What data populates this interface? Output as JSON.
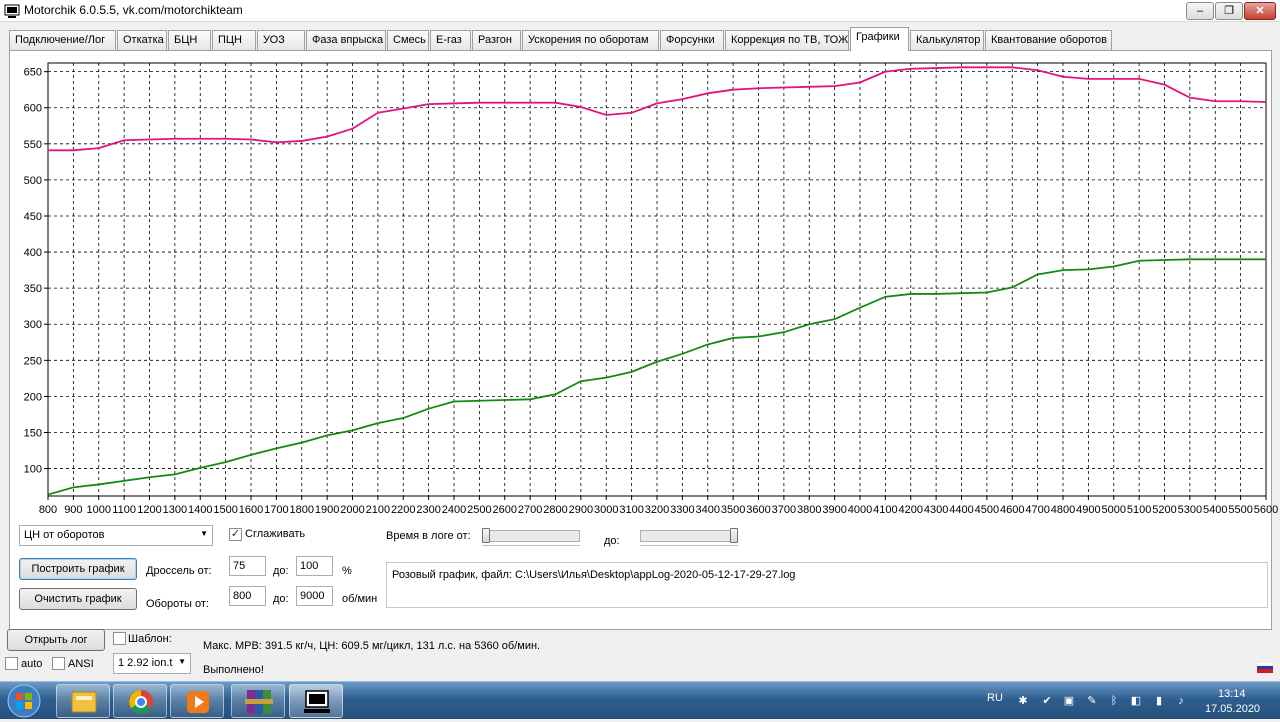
{
  "window": {
    "title": "Motorchik 6.0.5.5, vk.com/motorchikteam",
    "minimize": "–",
    "maximize": "❐",
    "close": "✕"
  },
  "tabs": [
    {
      "label": "Подключение/Лог"
    },
    {
      "label": "Откатка"
    },
    {
      "label": "БЦН"
    },
    {
      "label": "ПЦН"
    },
    {
      "label": "УОЗ"
    },
    {
      "label": "Фаза впрыска"
    },
    {
      "label": "Смесь"
    },
    {
      "label": "E-газ"
    },
    {
      "label": "Разгон"
    },
    {
      "label": "Ускорения по оборотам"
    },
    {
      "label": "Форсунки"
    },
    {
      "label": "Коррекция по ТВ, ТОЖ"
    },
    {
      "label": "Графики"
    },
    {
      "label": "Калькулятор"
    },
    {
      "label": "Квантование оборотов"
    }
  ],
  "active_tab": "Графики",
  "chart_data": {
    "type": "line",
    "x": [
      800,
      900,
      1000,
      1100,
      1200,
      1300,
      1400,
      1500,
      1600,
      1700,
      1800,
      1900,
      2000,
      2100,
      2200,
      2300,
      2400,
      2500,
      2600,
      2700,
      2800,
      2900,
      3000,
      3100,
      3200,
      3300,
      3400,
      3500,
      3600,
      3700,
      3800,
      3900,
      4000,
      4100,
      4200,
      4300,
      4400,
      4500,
      4600,
      4700,
      4800,
      4900,
      5000,
      5100,
      5200,
      5300,
      5400,
      5500,
      5600
    ],
    "xticks": [
      "800",
      "900",
      "1000",
      "1100",
      "1200",
      "1300",
      "1400",
      "1500",
      "1600",
      "1700",
      "1800",
      "1900",
      "2000",
      "2100",
      "2200",
      "2300",
      "2400",
      "2500",
      "2600",
      "2700",
      "2800",
      "2900",
      "3000",
      "3100",
      "3200",
      "3300",
      "3400",
      "3500",
      "3600",
      "3700",
      "3800",
      "3900",
      "4000",
      "4100",
      "4200",
      "4300",
      "4400",
      "4500",
      "4600",
      "4700",
      "4800",
      "4900",
      "5000",
      "5100",
      "5200",
      "5300",
      "5400",
      "5500",
      "5600"
    ],
    "yticks": [
      "100",
      "150",
      "200",
      "250",
      "300",
      "350",
      "400",
      "450",
      "500",
      "550",
      "600",
      "650"
    ],
    "xlim": [
      800,
      5600
    ],
    "ylim": [
      62,
      662
    ],
    "grid": true,
    "series": [
      {
        "color": "#e0147c",
        "values": [
          541,
          541,
          544,
          555,
          556,
          557,
          557,
          557,
          556,
          552,
          554,
          560,
          571,
          593,
          599,
          605,
          606,
          607,
          607,
          607,
          607,
          601,
          590,
          593,
          606,
          612,
          620,
          625,
          627,
          628,
          629,
          630,
          635,
          650,
          654,
          655,
          656,
          656,
          656,
          652,
          643,
          640,
          640,
          640,
          632,
          614,
          609,
          609,
          608
        ]
      },
      {
        "color": "#138a13",
        "values": [
          64,
          74,
          78,
          83,
          88,
          92,
          101,
          109,
          119,
          128,
          136,
          146,
          153,
          163,
          170,
          183,
          193,
          194,
          195,
          196,
          203,
          221,
          226,
          234,
          248,
          259,
          272,
          281,
          283,
          289,
          300,
          307,
          323,
          338,
          342,
          342,
          343,
          344,
          351,
          369,
          375,
          376,
          380,
          388,
          389,
          390,
          390,
          390,
          390
        ]
      }
    ]
  },
  "controls": {
    "graph_select": "ЦН от оборотов",
    "smooth_checked": true,
    "smooth_label": "Сглаживать",
    "log_time_from_label": "Время в логе от:",
    "log_time_to_label": "до:",
    "slider_from": 0.0,
    "slider_to": 1.0,
    "build_button": "Построить график",
    "clear_button": "Очистить график",
    "throttle_label": "Дроссель от:",
    "throttle_from": "75",
    "throttle_to_label": "до:",
    "throttle_to": "100",
    "throttle_unit": "%",
    "rpm_label": "Обороты от:",
    "rpm_from": "800",
    "rpm_to_label": "до:",
    "rpm_to": "9000",
    "rpm_unit": "об/мин",
    "info_text": "Розовый график, файл: C:\\Users\\Илья\\Desktop\\appLog-2020-05-12-17-29-27.log"
  },
  "bottom": {
    "open_log_button": "Открыть лог",
    "template_checked": false,
    "template_label": "Шаблон:",
    "summary": "Макс. МРВ: 391.5 кг/ч, ЦН: 609.5 мг/цикл, 131 л.с. на 5360 об/мин.",
    "auto_checked": false,
    "auto_label": "auto",
    "ansi_checked": false,
    "ansi_label": "ANSI",
    "template_select": "1 2.92 ion.t",
    "status": "Выполнено!"
  },
  "taskbar": {
    "start_icon": "windows-orb-icon",
    "items": [
      "explorer-icon",
      "chrome-icon",
      "media-player-icon",
      "winrar-icon",
      "motorchik-icon"
    ],
    "language": "RU",
    "time": "13:14",
    "date": "17.05.2020"
  },
  "colors": {
    "pink_series": "#e0147c",
    "green_series": "#138a13",
    "plot_background": "#ffffff"
  }
}
